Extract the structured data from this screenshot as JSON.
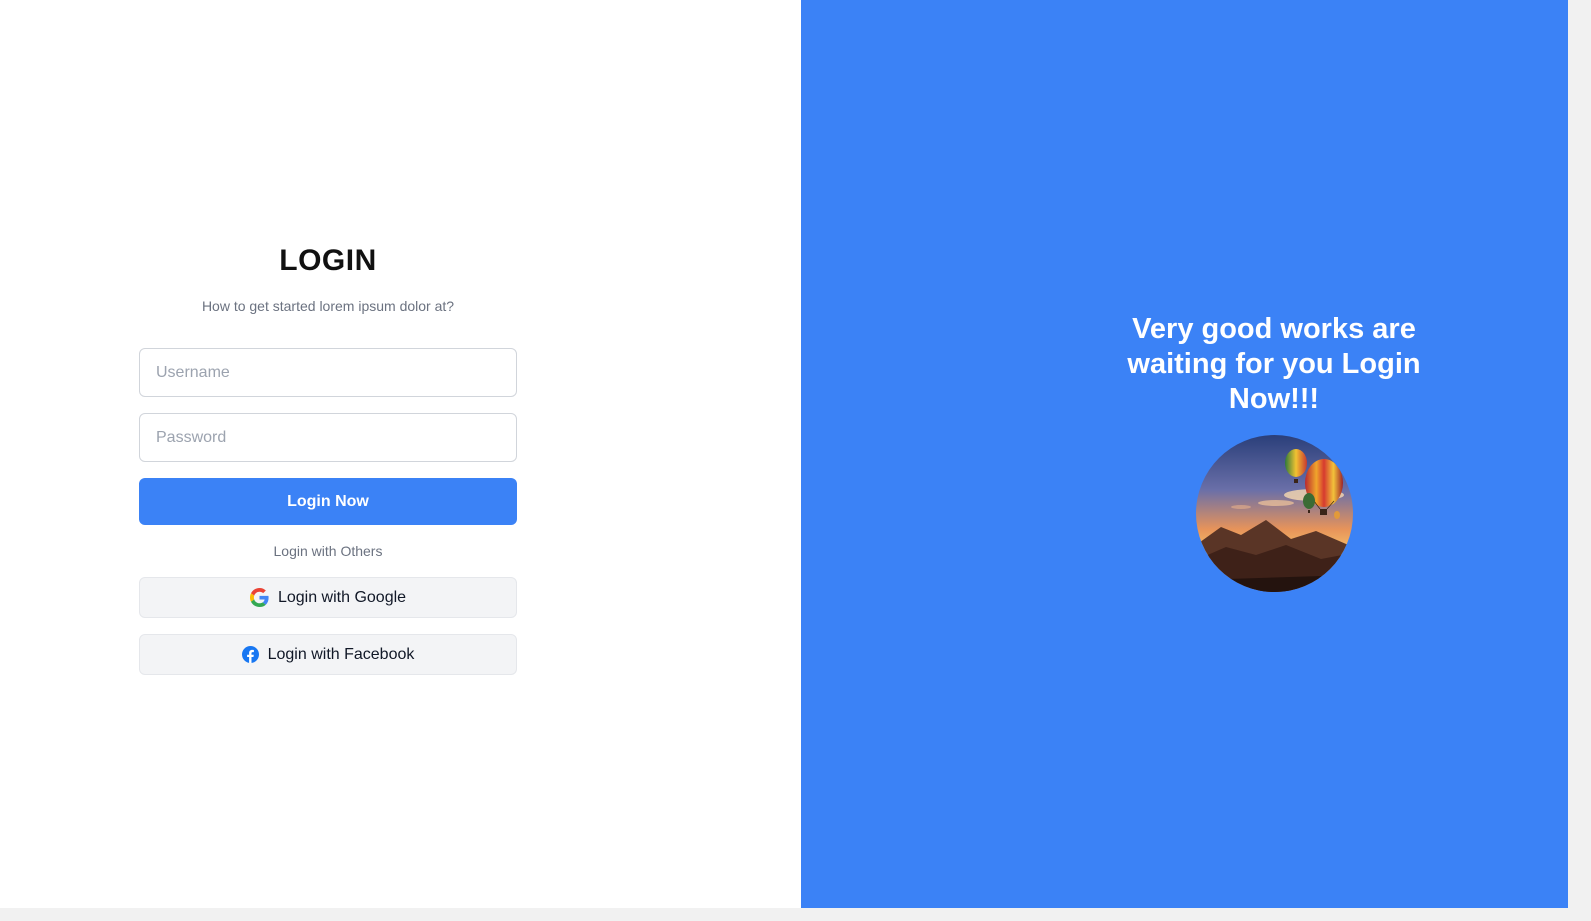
{
  "login": {
    "title": "LOGIN",
    "subtitle": "How to get started lorem ipsum dolor at?",
    "username_placeholder": "Username",
    "password_placeholder": "Password",
    "submit_label": "Login Now",
    "others_label": "Login with Others",
    "google_label": "Login with Google",
    "facebook_label": "Login with Facebook"
  },
  "promo": {
    "headline": "Very good works are waiting for you Login Now!!!",
    "image_icon": "hot-air-balloons-sunset-photo"
  },
  "icons": {
    "google": "google-icon",
    "facebook": "facebook-icon"
  },
  "colors": {
    "accent": "#3b82f6",
    "panel_bg": "#ffffff",
    "social_bg": "#f3f4f6",
    "facebook_blue": "#1877f2"
  }
}
